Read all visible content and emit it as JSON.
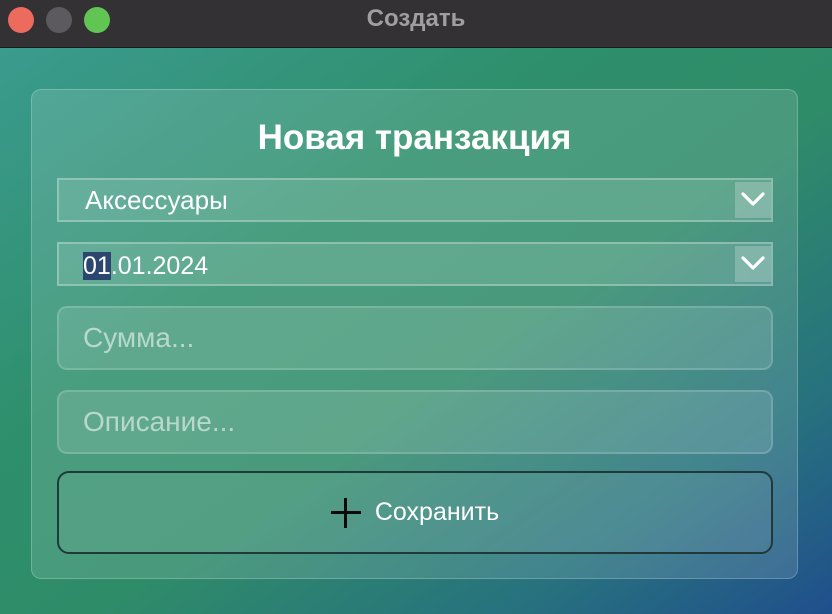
{
  "window": {
    "title": "Создать"
  },
  "form": {
    "heading": "Новая транзакция",
    "category": {
      "selected": "Аксессуары"
    },
    "date": {
      "value_highlighted": "01",
      "value_rest": ".01.2024"
    },
    "amount": {
      "placeholder": "Сумма..."
    },
    "description": {
      "placeholder": "Описание..."
    },
    "save_label": "Сохранить"
  },
  "icons": {
    "save": "plus-icon",
    "dropdown": "chevron-down-icon"
  },
  "colors": {
    "close": "#ed6a5e",
    "minimize": "#5c5a5e",
    "maximize": "#61c554",
    "selection": "#2c4670"
  }
}
